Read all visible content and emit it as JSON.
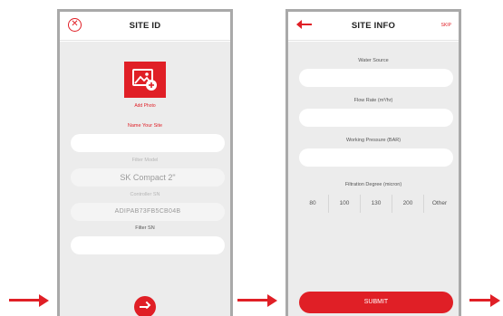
{
  "colors": {
    "accent": "#e01f26",
    "panel": "#ececec",
    "frame": "#a9a9a9"
  },
  "site_id_screen": {
    "title": "SITE ID",
    "close_icon": "close-icon",
    "photo_icon": "add-photo-icon",
    "add_photo_label": "Add Photo",
    "name_label": "Name Your Site",
    "name_value": "",
    "filter_model_label": "Filter Model",
    "filter_model_value": "SK Compact 2\"",
    "controller_sn_label": "Controller SN",
    "controller_sn_value": "ADIPAB73FB5CB04B",
    "filter_sn_label": "Filter SN",
    "filter_sn_value": "",
    "next_icon": "arrow-right-icon"
  },
  "site_info_screen": {
    "title": "SITE INFO",
    "back_icon": "arrow-left-icon",
    "skip_label": "SKIP",
    "water_source_label": "Water Source",
    "water_source_value": "",
    "flow_rate_label": "Flow Rate (m³/hr)",
    "flow_rate_value": "",
    "working_pressure_label": "Working Pressure (BAR)",
    "working_pressure_value": "",
    "filtration_degree_label": "Filtration Degree (micron)",
    "filtration_degree_options": [
      "80",
      "100",
      "130",
      "200",
      "Other"
    ],
    "submit_label": "SUBMIT"
  }
}
